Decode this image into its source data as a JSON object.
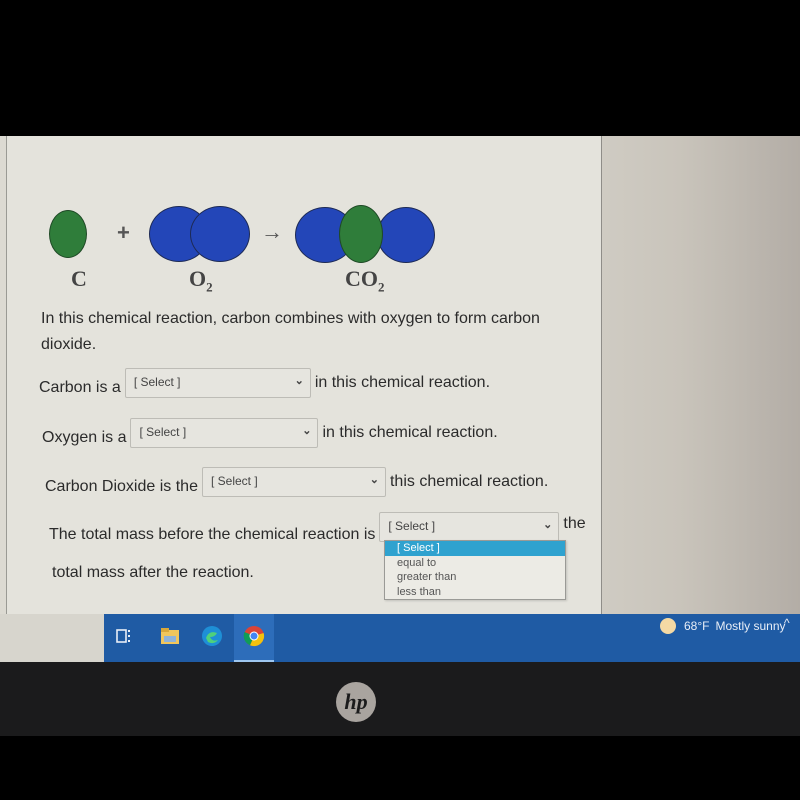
{
  "reaction": {
    "reactant_1": {
      "symbol": "C",
      "label": "C"
    },
    "plus": "+",
    "reactant_2": {
      "symbol": "O",
      "subscript": "2"
    },
    "arrow": "→",
    "product": {
      "symbol": "CO",
      "subscript": "2"
    },
    "colors": {
      "carbon": "#2f7d3a",
      "oxygen": "#2346b8"
    }
  },
  "intro_text": "In this chemical reaction, carbon combines with oxygen to form carbon dioxide.",
  "questions": [
    {
      "prefix": "Carbon is a",
      "select_value": "[ Select ]",
      "suffix": "in this chemical reaction."
    },
    {
      "prefix": "Oxygen is a",
      "select_value": "[ Select ]",
      "suffix": "in this chemical reaction."
    },
    {
      "prefix": "Carbon Dioxide is the",
      "select_value": "[ Select ]",
      "suffix": "this chemical reaction."
    },
    {
      "prefix": "The total mass before the chemical reaction is",
      "select_value": "[ Select ]",
      "suffix": "the",
      "continuation": "total mass after the reaction."
    }
  ],
  "open_dropdown": {
    "options": [
      "[ Select ]",
      "equal to",
      "greater than",
      "less than"
    ],
    "highlighted": "[ Select ]",
    "highlight_color": "#2fa2cf"
  },
  "taskbar": {
    "icons": [
      "task-view-icon",
      "file-explorer-icon",
      "edge-icon",
      "chrome-icon"
    ],
    "active": "chrome-icon",
    "weather": {
      "temperature": "68°F",
      "condition": "Mostly sunny"
    },
    "tray_chevron": "^",
    "color": "#1f5ba4"
  },
  "bezel": {
    "logo": "hp"
  }
}
